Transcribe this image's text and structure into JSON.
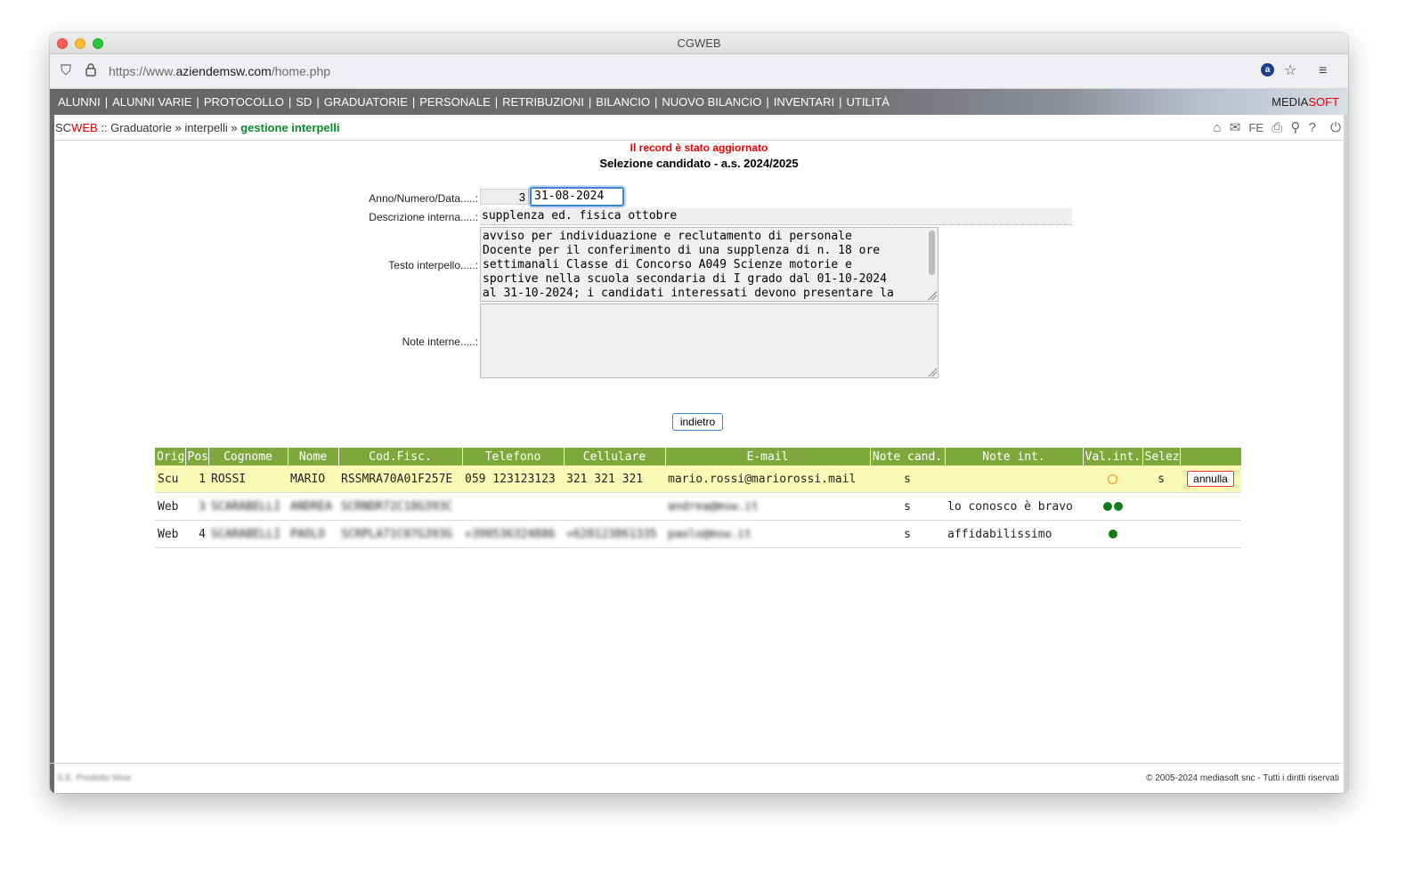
{
  "window": {
    "title": "CGWEB"
  },
  "browser": {
    "url_prefix": "https://www.",
    "url_domain": "aziendemsw.com",
    "url_path": "/home.php"
  },
  "menu": {
    "items": [
      "ALUNNI",
      "ALUNNI VARIE",
      "PROTOCOLLO",
      "SD",
      "GRADUATORIE",
      "PERSONALE",
      "RETRIBUZIONI",
      "BILANCIO",
      "NUOVO BILANCIO",
      "INVENTARI",
      "UTILITÀ"
    ],
    "separator": "|",
    "brand_a": "MEDIA",
    "brand_b": "SOFT"
  },
  "breadcrumb": {
    "sc": "SC",
    "web": "WEB",
    "sep": "::",
    "item1": "Graduatorie",
    "arrow": "»",
    "item2": "interpelli",
    "current": "gestione interpelli",
    "fe": "FE"
  },
  "page": {
    "message": "Il record è stato aggiornato",
    "subtitle": "Selezione candidato - a.s. 2024/2025"
  },
  "form": {
    "anno_label": "Anno/Numero/Data.....:",
    "numero": "3",
    "data": "31-08-2024",
    "desc_label": "Descrizione interna.....:",
    "descrizione": "supplenza ed. fisica ottobre",
    "testo_label": "Testo interpello.....:",
    "testo": "avviso per individuazione e reclutamento di personale\nDocente per il conferimento di una supplenza di n. 18 ore\nsettimanali Classe di Concorso A049 Scienze motorie e\nsportive nella scuola secondaria di I grado dal 01-10-2024\nal 31-10-2024; i candidati interessati devono presentare la",
    "note_label": "Note interne.....:",
    "note": "",
    "back_button": "indietro"
  },
  "table": {
    "headers": [
      "Orig",
      "Pos",
      "Cognome",
      "Nome",
      "Cod.Fisc.",
      "Telefono",
      "Cellulare",
      "E-mail",
      "Note cand.",
      "Note int.",
      "Val.int.",
      "Selez",
      ""
    ],
    "rows": [
      {
        "orig": "Scu",
        "pos": "1",
        "cognome": "ROSSI",
        "nome": "MARIO",
        "codfisc": "RSSMRA70A01F257E",
        "telefono": "059 123123123",
        "cellulare": "321 321 321",
        "email": "mario.rossi@mariorossi.mail",
        "note_cand": "s",
        "note_int": "",
        "selez": "s",
        "action": "annulla"
      },
      {
        "orig": "Web",
        "pos": "3",
        "cognome": "SCARABELLI",
        "nome": "ANDREA",
        "codfisc": "SCRNDR72C18G393C",
        "telefono": "",
        "cellulare": "",
        "email": "andrea@msw.it",
        "note_cand": "s",
        "note_int": "lo conosco è bravo",
        "selez": "",
        "action": ""
      },
      {
        "orig": "Web",
        "pos": "4",
        "cognome": "SCARABELLI",
        "nome": "PAOLO",
        "codfisc": "SCRPLA71C07G393G",
        "telefono": "+390536324886",
        "cellulare": "+628123861335",
        "email": "paolo@msw.it",
        "note_cand": "s",
        "note_int": "affidabilissimo",
        "selez": "",
        "action": ""
      }
    ]
  },
  "footer": {
    "left": "S.E. Prodotto Msw",
    "right": "© 2005-2024 mediasoft snc - Tutti i diritti riservati"
  },
  "icons": [
    "shield-icon",
    "lock-icon",
    "star-icon",
    "hamburger-icon",
    "home-icon",
    "mail-icon",
    "print-icon",
    "search-icon",
    "help-icon",
    "power-icon"
  ],
  "colors": {
    "table_header": "#7fa83c",
    "highlight_row": "#fbfab6",
    "accent_red": "#e60000",
    "accent_green": "#0a8a2a"
  }
}
